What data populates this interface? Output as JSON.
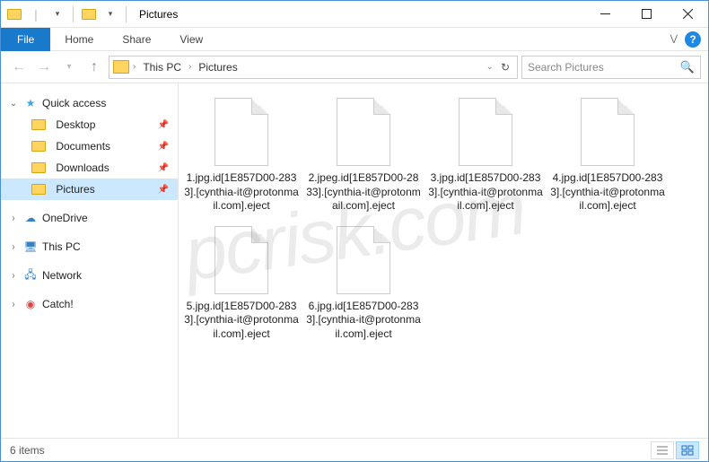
{
  "window": {
    "title": "Pictures"
  },
  "ribbon": {
    "file": "File",
    "tabs": [
      "Home",
      "Share",
      "View"
    ]
  },
  "breadcrumbs": {
    "root": "This PC",
    "current": "Pictures"
  },
  "search": {
    "placeholder": "Search Pictures"
  },
  "sidebar": {
    "quick": {
      "label": "Quick access"
    },
    "quick_items": [
      {
        "label": "Desktop"
      },
      {
        "label": "Documents"
      },
      {
        "label": "Downloads"
      },
      {
        "label": "Pictures",
        "selected": true
      }
    ],
    "roots": [
      {
        "label": "OneDrive",
        "icon": "cloud"
      },
      {
        "label": "This PC",
        "icon": "pc"
      },
      {
        "label": "Network",
        "icon": "net"
      },
      {
        "label": "Catch!",
        "icon": "catch"
      }
    ]
  },
  "files": [
    {
      "name": "1.jpg.id[1E857D00-2833].[cynthia-it@protonmail.com].eject"
    },
    {
      "name": "2.jpeg.id[1E857D00-2833].[cynthia-it@protonmail.com].eject"
    },
    {
      "name": "3.jpg.id[1E857D00-2833].[cynthia-it@protonmail.com].eject"
    },
    {
      "name": "4.jpg.id[1E857D00-2833].[cynthia-it@protonmail.com].eject"
    },
    {
      "name": "5.jpg.id[1E857D00-2833].[cynthia-it@protonmail.com].eject"
    },
    {
      "name": "6.jpg.id[1E857D00-2833].[cynthia-it@protonmail.com].eject"
    }
  ],
  "status": {
    "count": "6 items"
  },
  "watermark": "pcrisk.com"
}
